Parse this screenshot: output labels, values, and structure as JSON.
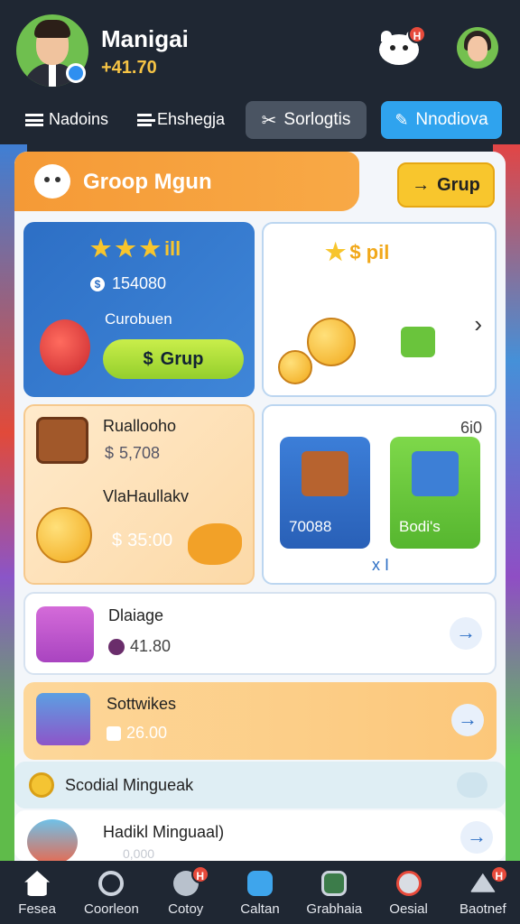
{
  "header": {
    "player_name": "Manigai",
    "player_coins": "+41.70",
    "notification_badge": "H",
    "tabs": [
      {
        "label": "Nadoins"
      },
      {
        "label": "Ehshegja"
      },
      {
        "label": "Sorlogtis"
      },
      {
        "label": "Nnodiova"
      }
    ]
  },
  "banner": {
    "title": "Groop Mgun",
    "button_label": "Grup"
  },
  "tiles": {
    "blue": {
      "stars_text": "ill",
      "amount": "154080",
      "subtitle": "Curobuen",
      "button_label": "Grup"
    },
    "white1": {
      "title": "$ pil"
    },
    "peach": {
      "item1_title": "Ruallooho",
      "item1_value": "5,708",
      "item2_title": "VlaHaullakv",
      "item2_value": "35:00"
    },
    "white2": {
      "corner_label": "6i0",
      "card1_label": "70088",
      "card2_label": "Bodi's",
      "footer_label": "x I"
    }
  },
  "rows": [
    {
      "title": "Dlaiage",
      "value": "41.80"
    },
    {
      "title": "Sottwikes",
      "value": "26.00"
    },
    {
      "title": "Scodial Mingueak",
      "value": ""
    },
    {
      "title": "Hadikl Minguaal)",
      "value": "0,000"
    }
  ],
  "bottom_nav": [
    {
      "label": "Fesea",
      "icon": "home-icon"
    },
    {
      "label": "Coorleon",
      "icon": "clock-icon"
    },
    {
      "label": "Cotoy",
      "icon": "gear-icon",
      "badge": "H"
    },
    {
      "label": "Caltan",
      "icon": "cube-icon"
    },
    {
      "label": "Grabhaia",
      "icon": "camera-icon"
    },
    {
      "label": "Oesial",
      "icon": "globe-icon"
    },
    {
      "label": "Baotnef",
      "icon": "hat-icon",
      "badge": "H"
    }
  ],
  "colors": {
    "background": "#1f2733",
    "banner": "#f59a36",
    "accent_blue": "#2d6fc5",
    "accent_yellow": "#f8c62d",
    "green_button": "#a9dd34"
  }
}
